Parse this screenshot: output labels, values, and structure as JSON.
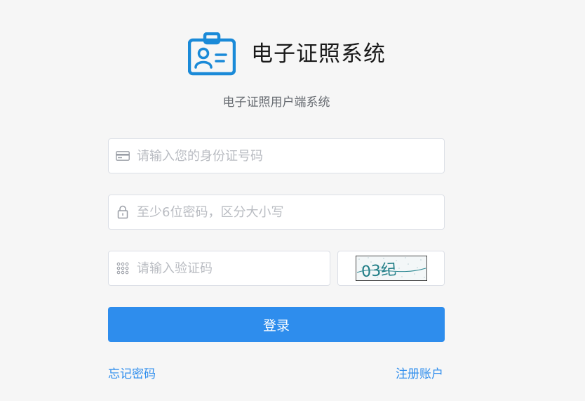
{
  "brand": {
    "title": "电子证照系统",
    "icon": "id-badge-icon",
    "color": "#1a8ad8"
  },
  "subtitle": "电子证照用户端系统",
  "form": {
    "id_number": {
      "placeholder": "请输入您的身份证号码",
      "icon": "id-card-icon",
      "value": ""
    },
    "password": {
      "placeholder": "至少6位密码，区分大小写",
      "icon": "lock-icon",
      "value": ""
    },
    "captcha": {
      "placeholder": "请输入验证码",
      "icon": "keypad-icon",
      "value": "",
      "image_text": "03纪"
    },
    "submit_label": "登录"
  },
  "links": {
    "forgot": "忘记密码",
    "register": "注册账户"
  },
  "colors": {
    "primary": "#2e8ded",
    "background": "#f6f6f6",
    "border": "#dcdfe6",
    "placeholder": "#b9bcc2"
  }
}
